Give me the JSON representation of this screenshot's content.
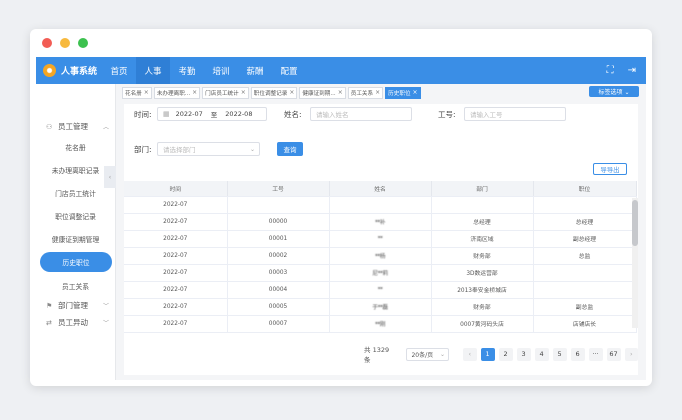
{
  "app": {
    "title": "人事系统"
  },
  "nav": {
    "items": [
      {
        "label": "首页"
      },
      {
        "label": "人事",
        "active": true
      },
      {
        "label": "考勤"
      },
      {
        "label": "培训"
      },
      {
        "label": "薪酬"
      },
      {
        "label": "配置"
      }
    ],
    "fullscreen_icon": "expand-icon",
    "logout_icon": "logout-icon"
  },
  "sidebar": {
    "groups": [
      {
        "label": "员工管理",
        "icon": "user-icon",
        "items": [
          {
            "label": "花名册"
          },
          {
            "label": "未办理离职记录"
          },
          {
            "label": "门店员工统计"
          },
          {
            "label": "职位调整记录"
          },
          {
            "label": "健康证到期管理"
          },
          {
            "label": "历史职位",
            "active": true
          },
          {
            "label": "员工关系"
          }
        ]
      },
      {
        "label": "部门管理",
        "icon": "department-icon"
      },
      {
        "label": "员工异动",
        "icon": "transfer-icon"
      }
    ]
  },
  "tabs": {
    "items": [
      {
        "label": "花名册"
      },
      {
        "label": "未办理离职..."
      },
      {
        "label": "门店员工统计"
      },
      {
        "label": "职位调整记录"
      },
      {
        "label": "健康证到期..."
      },
      {
        "label": "员工关系"
      },
      {
        "label": "历史职位",
        "active": true
      }
    ],
    "options_label": "标签选项 ⌄"
  },
  "filters": {
    "time_label": "时间:",
    "date_start": "2022-07",
    "date_sep": "至",
    "date_end": "2022-08",
    "name_label": "姓名:",
    "name_placeholder": "请输入姓名",
    "jobno_label": "工号:",
    "jobno_placeholder": "请输入工号",
    "dept_label": "部门:",
    "dept_placeholder": "请选择部门",
    "query_button": "查询",
    "export_button": "导导出"
  },
  "table": {
    "columns": [
      "时间",
      "工号",
      "姓名",
      "部门",
      "职位"
    ],
    "rows": [
      [
        "2022-07",
        "",
        "",
        "",
        ""
      ],
      [
        "2022-07",
        "00000",
        "**补",
        "总经理",
        "总经理"
      ],
      [
        "2022-07",
        "00001",
        "**",
        "济南区域",
        "副总经理"
      ],
      [
        "2022-07",
        "00002",
        "**杨",
        "财务部",
        "总监"
      ],
      [
        "2022-07",
        "00003",
        "尼**莉",
        "3D数运营部",
        ""
      ],
      [
        "2022-07",
        "00004",
        "**",
        "2013奉安金桥城店",
        ""
      ],
      [
        "2022-07",
        "00005",
        "于**磊",
        "财务部",
        "副总监"
      ],
      [
        "2022-07",
        "00007",
        "**刚",
        "0007黄河码头店",
        "店铺店长"
      ]
    ]
  },
  "pagination": {
    "total": "共 1329 条",
    "page_size": "20条/页",
    "pages": [
      "1",
      "2",
      "3",
      "4",
      "5",
      "6",
      "···",
      "67"
    ],
    "current": "1"
  }
}
